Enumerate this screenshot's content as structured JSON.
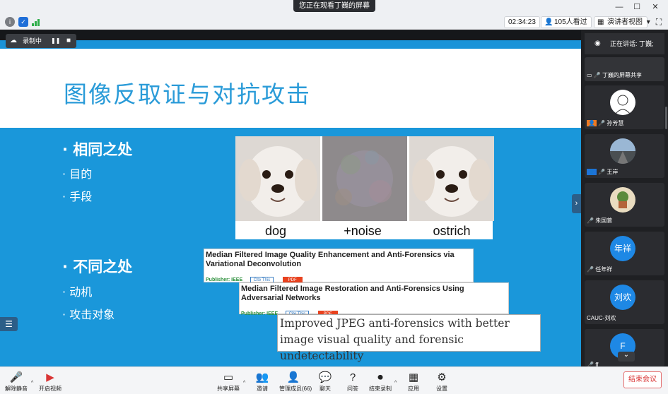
{
  "window": {
    "sharing_text": "您正在观看丁巍的屏幕",
    "minimize": "—",
    "restore": "☐",
    "close": "✕"
  },
  "topbar": {
    "timer": "02:34:23",
    "viewers": "105人看过",
    "view_mode": "演讲者视图",
    "view_caret": "▾",
    "fullscreen": "⛶"
  },
  "recording": {
    "label": "录制中",
    "pause": "❚❚",
    "stop": "■"
  },
  "slide": {
    "title": "图像反取证与对抗攻击",
    "bullets": [
      {
        "text": "相同之处"
      },
      {
        "text": "目的"
      },
      {
        "text": "手段"
      },
      {
        "text": "不同之处"
      },
      {
        "text": "动机"
      },
      {
        "text": "攻击对象"
      }
    ],
    "bullet_mark": "·",
    "dog_labels": [
      "dog",
      "+noise",
      "ostrich"
    ],
    "papers": [
      {
        "title": "Median Filtered Image Quality Enhancement and Anti-Forensics via Variational Deconvolution",
        "publisher": "Publisher: IEEE",
        "cite": "Cite This",
        "pdf": "PDF"
      },
      {
        "title": "Median Filtered Image Restoration and Anti-Forensics Using Adversarial Networks",
        "publisher": "Publisher: IEEE",
        "cite": "Cite This",
        "pdf": "PDF"
      }
    ],
    "serif_text": "Improved JPEG anti-forensics with better image visual quality and forensic undetectability",
    "nav_arrow": "›",
    "list_icon": "☰"
  },
  "participants": {
    "speaker_label": "正在讲话: 丁巍;",
    "tiles": [
      {
        "name": "丁巍的屏幕共享"
      },
      {
        "name": "孙芳慧"
      },
      {
        "name": "王岸"
      },
      {
        "name": "朱国普"
      },
      {
        "name": "任年祥",
        "avatar_text": "年祥",
        "avatar_color": "#1e88e5"
      },
      {
        "name": "CAUC-刘欢",
        "avatar_text": "刘欢",
        "avatar_color": "#1e88e5"
      },
      {
        "name": "ff",
        "avatar_text": "F",
        "avatar_color": "#1e88e5"
      }
    ],
    "scroll_down": "⌄"
  },
  "bottombar": {
    "buttons": [
      {
        "label": "解除静音",
        "icon": "microphone-muted-icon"
      },
      {
        "label": "开启视频",
        "icon": "video-off-icon"
      },
      {
        "label": "共享屏幕",
        "icon": "share-screen-icon"
      },
      {
        "label": "邀请",
        "icon": "invite-icon"
      },
      {
        "label": "管理成员(66)",
        "icon": "members-icon"
      },
      {
        "label": "聊天",
        "icon": "chat-icon"
      },
      {
        "label": "问答",
        "icon": "qa-icon"
      },
      {
        "label": "结束录制",
        "icon": "stop-record-icon"
      },
      {
        "label": "应用",
        "icon": "apps-icon"
      },
      {
        "label": "设置",
        "icon": "settings-icon"
      }
    ],
    "caret": "^",
    "end_meeting": "结束会议"
  },
  "colors": {
    "slide_blue": "#1a97da",
    "title_blue": "#2a9bd8",
    "end_red": "#d93535"
  }
}
